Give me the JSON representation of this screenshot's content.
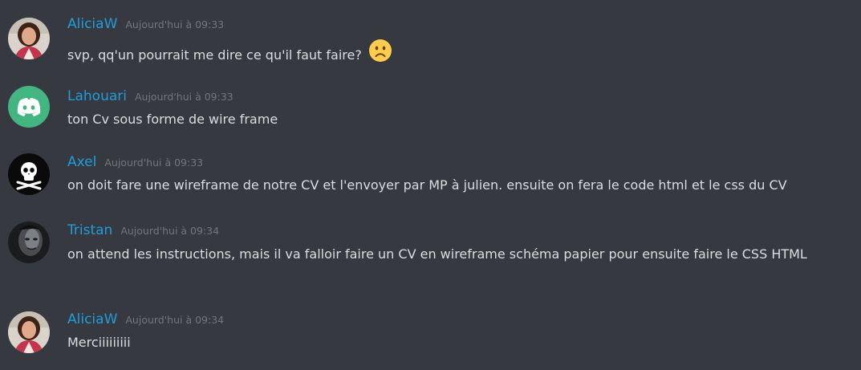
{
  "messages": [
    {
      "username": "AliciaW",
      "timestamp": "Aujourd'hui à 09:33",
      "text": "svp, qq'un pourrait me dire ce qu'il faut faire?",
      "emoji": "slightly-frowning-face-icon",
      "avatar": "woman-photo-avatar"
    },
    {
      "username": "Lahouari",
      "timestamp": "Aujourd'hui à 09:33",
      "text": "ton Cv sous forme de wire frame",
      "avatar": "discord-logo-avatar"
    },
    {
      "username": "Axel",
      "timestamp": "Aujourd'hui à 09:33",
      "text": "on doit fare une wireframe de notre CV et l'envoyer par MP à julien. ensuite on fera le code html et le css du CV",
      "avatar": "jolly-roger-avatar"
    },
    {
      "username": "Tristan",
      "timestamp": "Aujourd'hui à 09:34",
      "text": "on attend les instructions, mais il va falloir faire un CV en wireframe schéma papier pour ensuite faire le CSS HTML",
      "avatar": "dark-face-avatar"
    },
    {
      "username": "AliciaW",
      "timestamp": "Aujourd'hui à 09:34",
      "text": "Merciiiiiiiii",
      "avatar": "woman-photo-avatar"
    }
  ],
  "colors": {
    "background": "#36393f",
    "username": "#1f9edb",
    "timestamp": "#72767d",
    "text": "#dcddde",
    "discord_green": "#43b581"
  }
}
